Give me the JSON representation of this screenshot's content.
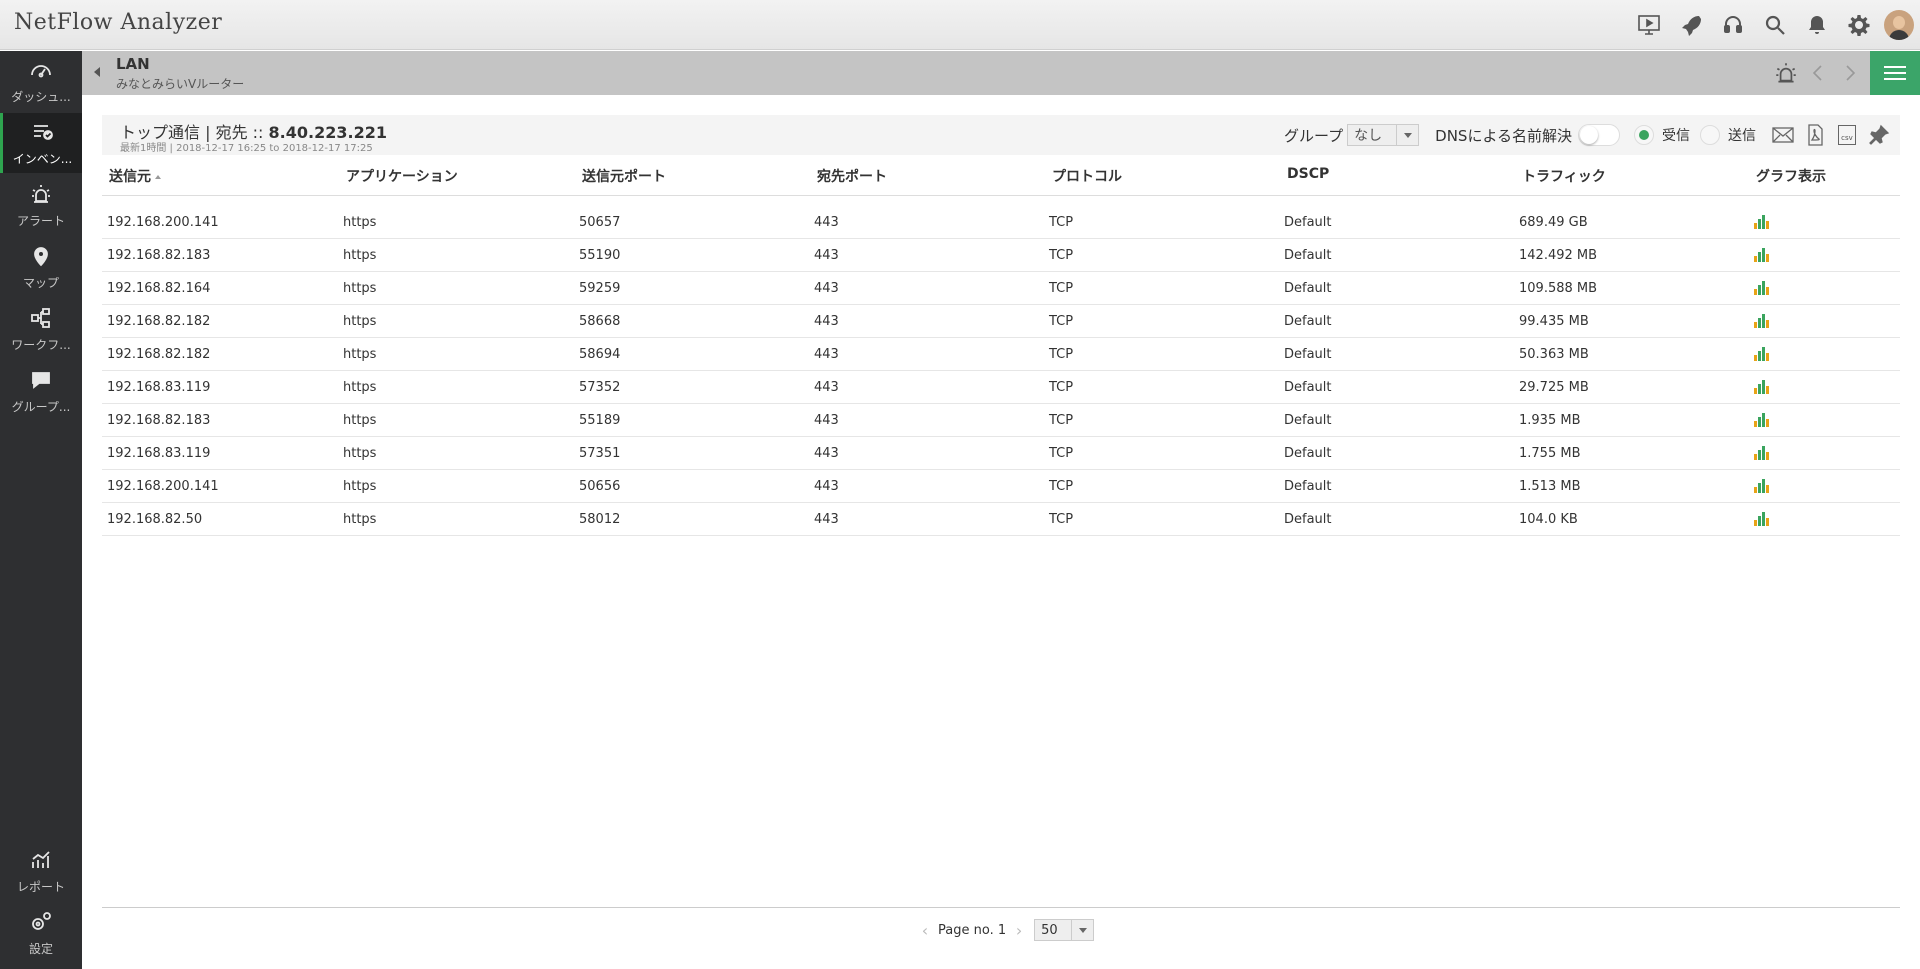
{
  "app": {
    "title": "NetFlow Analyzer"
  },
  "topbar": {
    "icons": [
      "presentation-icon",
      "rocket-icon",
      "headset-icon",
      "search-icon",
      "bell-icon",
      "gear-icon",
      "avatar"
    ]
  },
  "sidebar": {
    "items": [
      {
        "label": "ダッシュ...",
        "icon": "dashboard-icon",
        "active": false
      },
      {
        "label": "インベン...",
        "icon": "inventory-icon",
        "active": true
      },
      {
        "label": "アラート",
        "icon": "alarm-icon",
        "active": false
      },
      {
        "label": "マップ",
        "icon": "map-pin-icon",
        "active": false
      },
      {
        "label": "ワークフ...",
        "icon": "workflow-icon",
        "active": false
      },
      {
        "label": "グループ...",
        "icon": "chat-icon",
        "active": false
      },
      {
        "label": "レポート",
        "icon": "report-icon",
        "active": false
      },
      {
        "label": "設定",
        "icon": "settings-icon",
        "active": false
      }
    ]
  },
  "subheader": {
    "title": "LAN",
    "subtitle": "みなとみらいVルーター"
  },
  "panel": {
    "title_prefix": "トップ通信 | 宛先 :: ",
    "title_ip": "8.40.223.221",
    "subtitle": "最新1時間 | 2018-12-17 16:25 to 2018-12-17 17:25",
    "group_label": "グループ",
    "group_value": "なし",
    "dns_label": "DNSによる名前解決",
    "receive_label": "受信",
    "send_label": "送信",
    "selected_direction": "受信"
  },
  "table": {
    "columns": [
      "送信元",
      "アプリケーション",
      "送信元ポート",
      "宛先ポート",
      "プロトコル",
      "DSCP",
      "トラフィック",
      "グラフ表示"
    ],
    "sorted_by": "送信元",
    "rows": [
      [
        "192.168.200.141",
        "https",
        "50657",
        "443",
        "TCP",
        "Default",
        "689.49 GB"
      ],
      [
        "192.168.82.183",
        "https",
        "55190",
        "443",
        "TCP",
        "Default",
        "142.492 MB"
      ],
      [
        "192.168.82.164",
        "https",
        "59259",
        "443",
        "TCP",
        "Default",
        "109.588 MB"
      ],
      [
        "192.168.82.182",
        "https",
        "58668",
        "443",
        "TCP",
        "Default",
        "99.435 MB"
      ],
      [
        "192.168.82.182",
        "https",
        "58694",
        "443",
        "TCP",
        "Default",
        "50.363 MB"
      ],
      [
        "192.168.83.119",
        "https",
        "57352",
        "443",
        "TCP",
        "Default",
        "29.725 MB"
      ],
      [
        "192.168.82.183",
        "https",
        "55189",
        "443",
        "TCP",
        "Default",
        "1.935 MB"
      ],
      [
        "192.168.83.119",
        "https",
        "57351",
        "443",
        "TCP",
        "Default",
        "1.755 MB"
      ],
      [
        "192.168.200.141",
        "https",
        "50656",
        "443",
        "TCP",
        "Default",
        "1.513 MB"
      ],
      [
        "192.168.82.50",
        "https",
        "58012",
        "443",
        "TCP",
        "Default",
        "104.0 KB"
      ]
    ]
  },
  "pagination": {
    "page_label": "Page no. 1",
    "per_page": "50"
  },
  "colors": {
    "accent_green": "#3ba569",
    "sidebar_bg": "#2e2f31",
    "graph_bar_green": "#3aa45e",
    "graph_bar_orange": "#e8a317"
  }
}
